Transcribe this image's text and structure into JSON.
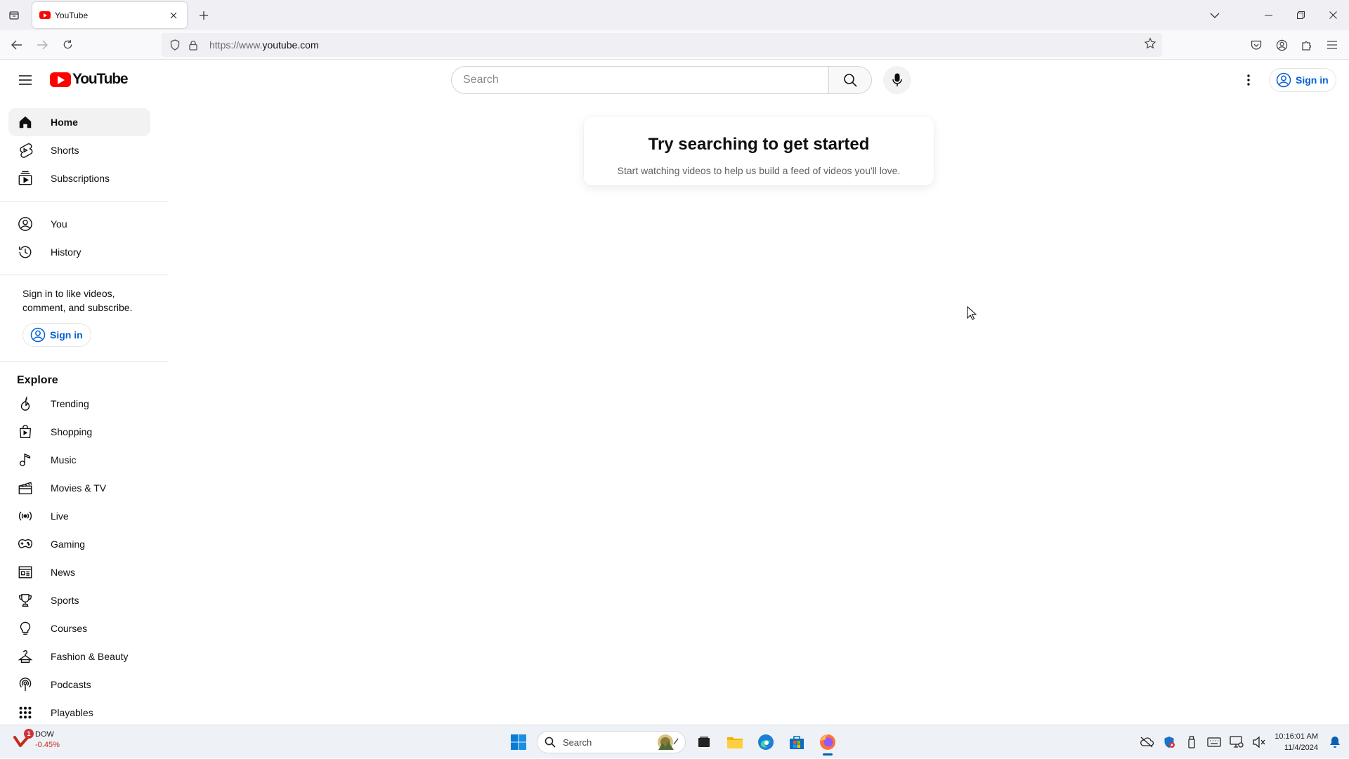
{
  "browser": {
    "tab_title": "YouTube",
    "url_prefix": "https://www.",
    "url_domain": "youtube.com"
  },
  "masthead": {
    "logo_text": "YouTube",
    "search_placeholder": "Search",
    "signin_label": "Sign in"
  },
  "sidebar": {
    "primary": [
      {
        "label": "Home",
        "icon": "home-icon"
      },
      {
        "label": "Shorts",
        "icon": "shorts-icon"
      },
      {
        "label": "Subscriptions",
        "icon": "subscriptions-icon"
      }
    ],
    "you": [
      {
        "label": "You",
        "icon": "account-circle-icon"
      },
      {
        "label": "History",
        "icon": "history-icon"
      }
    ],
    "signin_prompt": "Sign in to like videos, comment, and subscribe.",
    "signin_label": "Sign in",
    "explore_title": "Explore",
    "explore": [
      {
        "label": "Trending",
        "icon": "trending-icon"
      },
      {
        "label": "Shopping",
        "icon": "shopping-bag-icon"
      },
      {
        "label": "Music",
        "icon": "music-note-icon"
      },
      {
        "label": "Movies & TV",
        "icon": "clapperboard-icon"
      },
      {
        "label": "Live",
        "icon": "live-broadcast-icon"
      },
      {
        "label": "Gaming",
        "icon": "gamepad-icon"
      },
      {
        "label": "News",
        "icon": "newspaper-icon"
      },
      {
        "label": "Sports",
        "icon": "trophy-icon"
      },
      {
        "label": "Courses",
        "icon": "lightbulb-icon"
      },
      {
        "label": "Fashion & Beauty",
        "icon": "hanger-icon"
      },
      {
        "label": "Podcasts",
        "icon": "podcast-icon"
      },
      {
        "label": "Playables",
        "icon": "grid-dots-icon"
      }
    ]
  },
  "main": {
    "empty_title": "Try searching to get started",
    "empty_subtitle": "Start watching videos to help us build a feed of videos you'll love."
  },
  "taskbar": {
    "widget_badge": "1",
    "widget_name": "DOW",
    "widget_value": "-0.45%",
    "search_label": "Search",
    "time": "10:16:01 AM",
    "date": "11/4/2024"
  },
  "colors": {
    "youtube_red": "#ff0000",
    "link_blue": "#065fd4",
    "stock_down": "#c42b1c"
  }
}
